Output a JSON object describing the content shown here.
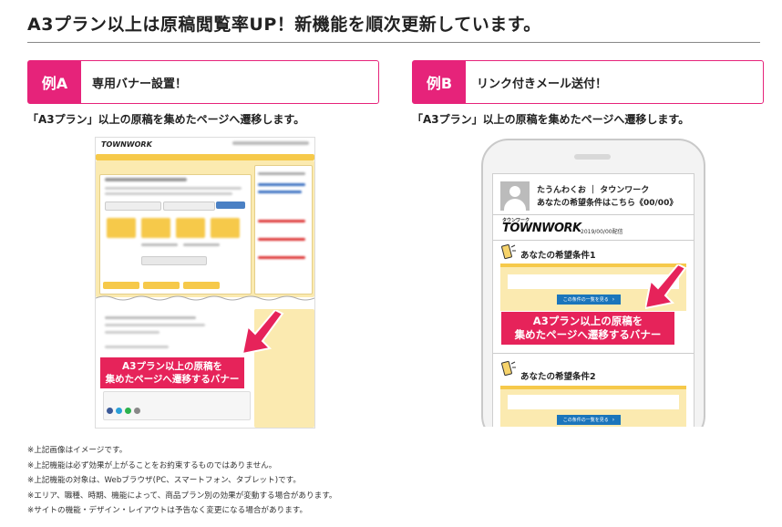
{
  "header": {
    "title": "A3プラン以上は原稿閲覧率UP！新機能を順次更新しています。"
  },
  "examples": [
    {
      "tag": "例A",
      "label": "専用バナー設置！",
      "description": "「A3プラン」以上の原稿を集めたページへ遷移します。",
      "banner_lines": [
        "A3プラン以上の原稿を",
        "集めたページへ遷移するバナー"
      ]
    },
    {
      "tag": "例B",
      "label": "リンク付きメール送付！",
      "description": "「A3プラン」以上の原稿を集めたページへ遷移します。",
      "banner_lines": [
        "A3プラン以上の原稿を",
        "集めたページへ遷移するバナー"
      ]
    }
  ],
  "phone": {
    "sender_line1": "たうんわくお ｜ タウンワーク",
    "sender_line2": "あなたの希望条件はこちら《00/00》",
    "logo_small": "タウンワーク",
    "logo": "TOWNWORK",
    "date": "2019/00/00配信",
    "section1": "あなたの希望条件1",
    "section2": "あなたの希望条件2",
    "button_label": "この条件の一覧を見る"
  },
  "site_a": {
    "logo": "TOWNWORK"
  },
  "notes": [
    "※上記画像はイメージです。",
    "※上記機能は必ず効果が上がることをお約束するものではありません。",
    "※上記機能の対象は、Webブラウザ(PC、スマートフォン、タブレット)です。",
    "※エリア、職種、時期、機能によって、商品プラン別の効果が変動する場合があります。",
    "※サイトの機能・デザイン・レイアウトは予告なく変更になる場合があります。"
  ],
  "colors": {
    "accent": "#e6237a",
    "banner": "#e6235a",
    "yellow": "#f6d36b",
    "button_blue": "#1b75bb"
  }
}
